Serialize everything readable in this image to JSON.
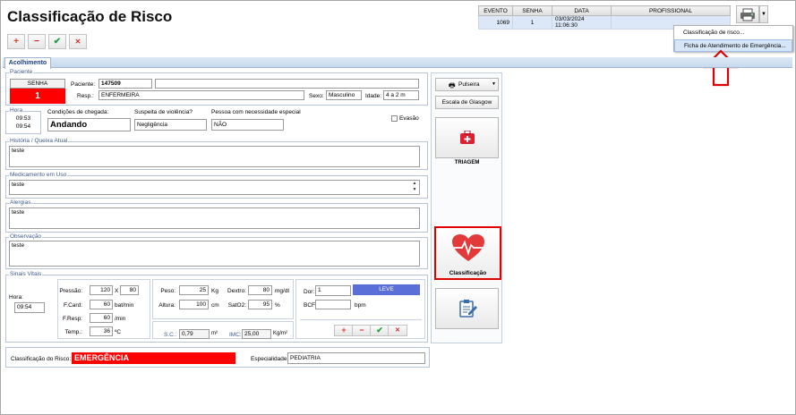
{
  "app": {
    "title": "Classificação de Risco"
  },
  "toolbar": {
    "add": "+",
    "remove": "−",
    "confirm": "✔",
    "cancel": "✕"
  },
  "events": {
    "headers": [
      "EVENTO",
      "SENHA",
      "DATA",
      "PROFISSIONAL"
    ],
    "rows": [
      {
        "evento": "1069",
        "senha": "1",
        "data": "03/03/2024 11:06:30",
        "profissional": ""
      }
    ]
  },
  "menu": {
    "items": [
      "Classificação de risco...",
      "Ficha de Atendimento de Emergência..."
    ]
  },
  "tabs": {
    "active": "Acolhimento"
  },
  "paciente": {
    "legend": "Paciente",
    "senha_label": "SENHA",
    "senha": "1",
    "paciente_label": "Paciente:",
    "paciente_id": "147509",
    "paciente_nome": "",
    "resp_label": "Resp.:",
    "resp": "ENFERMEIRA",
    "sexo_label": "Sexo:",
    "sexo": "Masculino",
    "idade_label": "Idade:",
    "idade": "4 a 2 m"
  },
  "hora": {
    "legend": "Hora",
    "h1": "09:53",
    "h2": "09:54"
  },
  "chegada": {
    "label": "Condições de chegada:",
    "value": "Andando"
  },
  "violencia": {
    "label": "Suspeita de violência?",
    "value": "Negligência"
  },
  "necessidade": {
    "label": "Pessoa com necessidade especial",
    "value": "NÃO"
  },
  "evasao": {
    "label": "Evasão"
  },
  "historia": {
    "legend": "História / Queixa Atual",
    "value": "teste"
  },
  "medicamento": {
    "legend": "Medicamento em Uso",
    "value": "teste"
  },
  "alergias": {
    "legend": "Alergias",
    "value": "teste"
  },
  "observacao": {
    "legend": "Observação",
    "value": "teste"
  },
  "sinais": {
    "legend": "Sinais Vitais",
    "hora_label": "Hora:",
    "hora": "09:54",
    "pressao_label": "Pressão:",
    "pressao1": "120",
    "x": "X",
    "pressao2": "80",
    "fcard_label": "F.Card:",
    "fcard": "60",
    "fcard_unit": "bat/min",
    "fresp_label": "F.Resp:",
    "fresp": "60",
    "fresp_unit": "/min",
    "temp_label": "Temp.:",
    "temp": "36",
    "temp_unit": "ºC",
    "peso_label": "Peso:",
    "peso": "25",
    "peso_unit": "Kg",
    "altura_label": "Altura:",
    "altura": "100",
    "altura_unit": "cm",
    "dextro_label": "Dextro:",
    "dextro": "80",
    "dextro_unit": "mg/dl",
    "sat_label": "SatO2:",
    "sat": "95",
    "sat_unit": "%",
    "sc_label": "S.C.:",
    "sc": "0,79",
    "sc_unit": "m²",
    "imc_label": "IMC:",
    "imc": "25,00",
    "imc_unit": "Kg/m²",
    "dor_label": "Dor:",
    "dor": "1",
    "dor_level": "LEVE",
    "bcf_label": "BCF:",
    "bcf": "",
    "bcf_unit": "bpm"
  },
  "classificacao": {
    "label": "Classificação do Risco:",
    "value": "EMERGÊNCIA",
    "esp_label": "Especialidade:",
    "esp": "PEDIATRIA"
  },
  "side": {
    "pulseira": "Pulseira",
    "glasgow": "Escala de Glasgow",
    "triagem": "TRIAGEM",
    "classificacao": "Classificação"
  },
  "colors": {
    "red": "#ff0000",
    "accent": "#1a3d7a",
    "dor": "#5a6fd8",
    "highlight": "#e00000"
  }
}
